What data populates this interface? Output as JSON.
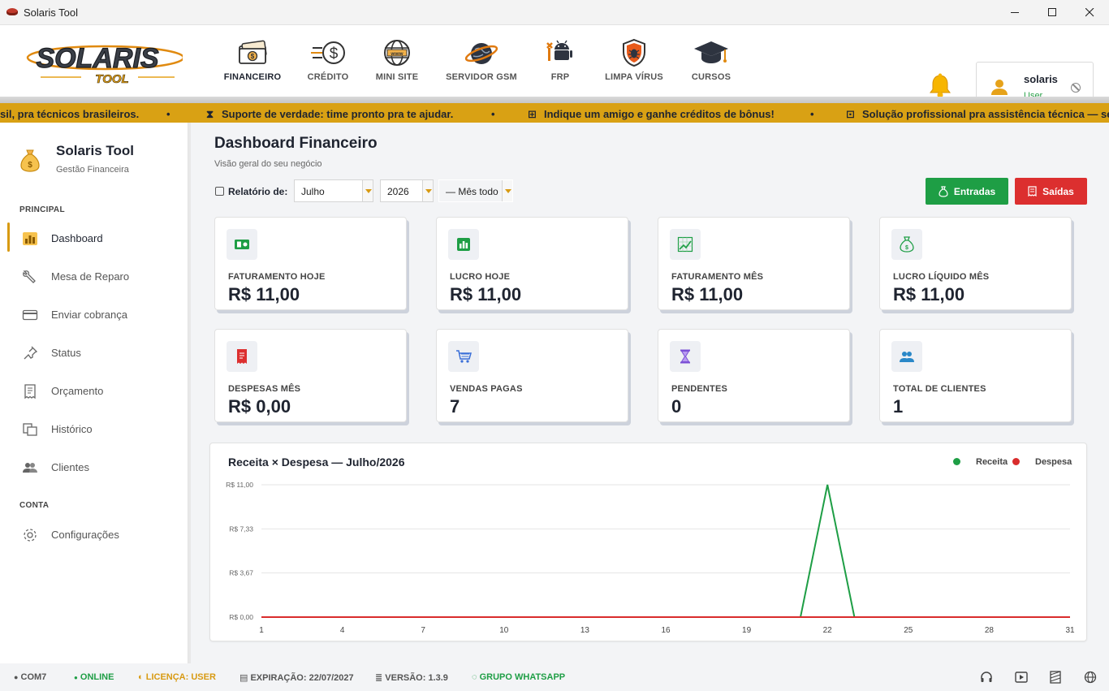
{
  "window": {
    "title": "Solaris Tool"
  },
  "nav": {
    "items": [
      {
        "label": "FINANCEIRO"
      },
      {
        "label": "CRÉDITO"
      },
      {
        "label": "MINI SITE"
      },
      {
        "label": "SERVIDOR GSM"
      },
      {
        "label": "FRP"
      },
      {
        "label": "LIMPA VÍRUS"
      },
      {
        "label": "CURSOS"
      }
    ],
    "active": "FINANCEIRO"
  },
  "user": {
    "name": "solaris",
    "role": "User"
  },
  "ticker": {
    "items": [
      "sil, pra técnicos brasileiros.",
      "•",
      "Suporte de verdade: time pronto pra te ajudar.",
      "•",
      "Indique um amigo e ganhe créditos de bônus!",
      "•",
      "Solução profissional pra assistência técnica — seg"
    ],
    "color": "#d9a114"
  },
  "sidebar": {
    "brand_name": "Solaris Tool",
    "brand_sub": "Gestão Financeira",
    "section_principal": "PRINCIPAL",
    "section_conta": "CONTA",
    "items": [
      {
        "label": "Dashboard",
        "icon": "bar-chart-icon"
      },
      {
        "label": "Mesa de Reparo",
        "icon": "wrench-icon"
      },
      {
        "label": "Enviar cobrança",
        "icon": "card-icon"
      },
      {
        "label": "Status",
        "icon": "pin-icon"
      },
      {
        "label": "Orçamento",
        "icon": "receipt-icon"
      },
      {
        "label": "Histórico",
        "icon": "history-icon"
      },
      {
        "label": "Clientes",
        "icon": "users-icon"
      }
    ],
    "conta_items": [
      {
        "label": "Configurações",
        "icon": "gear-icon"
      }
    ]
  },
  "main": {
    "title": "Dashboard Financeiro",
    "subtitle": "Visão geral do seu negócio",
    "report_label": "Relatório de:",
    "month": "Julho",
    "year": "2026",
    "period": "— Mês todo",
    "btn_in": "Entradas",
    "btn_out": "Saídas",
    "accent": "#d89a12"
  },
  "cards": [
    {
      "label": "FATURAMENTO HOJE",
      "value": "R$ 11,00",
      "icon": "cash-icon"
    },
    {
      "label": "LUCRO HOJE",
      "value": "R$ 11,00",
      "icon": "bar-chart-icon"
    },
    {
      "label": "FATURAMENTO MÊS",
      "value": "R$ 11,00",
      "icon": "growth-chart-icon"
    },
    {
      "label": "LUCRO LÍQUIDO MÊS",
      "value": "R$ 11,00",
      "icon": "money-bag-icon"
    },
    {
      "label": "DESPESAS MÊS",
      "value": "R$ 0,00",
      "icon": "receipt-icon"
    },
    {
      "label": "VENDAS PAGAS",
      "value": "7",
      "icon": "cart-icon"
    },
    {
      "label": "PENDENTES",
      "value": "0",
      "icon": "hourglass-icon"
    },
    {
      "label": "TOTAL DE CLIENTES",
      "value": "1",
      "icon": "users-icon"
    }
  ],
  "chart_data": {
    "type": "line",
    "title": "Receita × Despesa — Julho/2026",
    "x": [
      1,
      2,
      3,
      4,
      5,
      6,
      7,
      8,
      9,
      10,
      11,
      12,
      13,
      14,
      15,
      16,
      17,
      18,
      19,
      20,
      21,
      22,
      23,
      24,
      25,
      26,
      27,
      28,
      29,
      30,
      31
    ],
    "xticks": [
      "1",
      "4",
      "7",
      "10",
      "13",
      "16",
      "19",
      "22",
      "25",
      "28",
      "31"
    ],
    "yticks": [
      "R$ 0,00",
      "R$ 3,67",
      "R$ 7,33",
      "R$ 11,00"
    ],
    "ylim": [
      0,
      11
    ],
    "grid": true,
    "legend_position": "top-right",
    "series": [
      {
        "name": "Receita",
        "color": "#1e9e45",
        "values": [
          0,
          0,
          0,
          0,
          0,
          0,
          0,
          0,
          0,
          0,
          0,
          0,
          0,
          0,
          0,
          0,
          0,
          0,
          0,
          0,
          0,
          11,
          0,
          0,
          0,
          0,
          0,
          0,
          0,
          0,
          0
        ]
      },
      {
        "name": "Despesa",
        "color": "#d92c2c",
        "values": [
          0,
          0,
          0,
          0,
          0,
          0,
          0,
          0,
          0,
          0,
          0,
          0,
          0,
          0,
          0,
          0,
          0,
          0,
          0,
          0,
          0,
          0,
          0,
          0,
          0,
          0,
          0,
          0,
          0,
          0,
          0
        ]
      }
    ]
  },
  "status": {
    "port": "COM7",
    "online": "ONLINE",
    "license": "LICENÇA: USER",
    "expiration": "EXPIRAÇÃO: 22/07/2027",
    "version": "VERSÃO: 1.3.9",
    "whatsapp": "GRUPO WHATSAPP"
  }
}
